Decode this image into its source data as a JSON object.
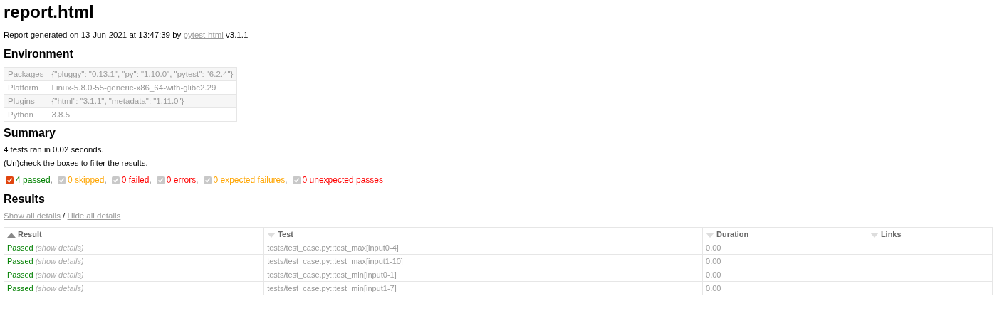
{
  "title": "report.html",
  "generated": {
    "prefix": "Report generated on 13-Jun-2021 at 13:47:39 by",
    "link": "pytest-html",
    "suffix": "v3.1.1"
  },
  "environment": {
    "heading": "Environment",
    "rows": [
      {
        "key": "Packages",
        "value": "{\"pluggy\": \"0.13.1\", \"py\": \"1.10.0\", \"pytest\": \"6.2.4\"}"
      },
      {
        "key": "Platform",
        "value": "Linux-5.8.0-55-generic-x86_64-with-glibc2.29"
      },
      {
        "key": "Plugins",
        "value": "{\"html\": \"3.1.1\", \"metadata\": \"1.11.0\"}"
      },
      {
        "key": "Python",
        "value": "3.8.5"
      }
    ]
  },
  "summary": {
    "heading": "Summary",
    "lines": [
      "4 tests ran in 0.02 seconds.",
      "(Un)check the boxes to filter the results."
    ],
    "filters": [
      {
        "label": "4 passed",
        "separator": ",",
        "checked": true,
        "disabled": false,
        "color": "#008000"
      },
      {
        "label": "0 skipped",
        "separator": ",",
        "checked": true,
        "disabled": true,
        "color": "#ffa500"
      },
      {
        "label": "0 failed",
        "separator": ",",
        "checked": true,
        "disabled": true,
        "color": "#ff0000"
      },
      {
        "label": "0 errors",
        "separator": ",",
        "checked": true,
        "disabled": true,
        "color": "#ff0000"
      },
      {
        "label": "0 expected failures",
        "separator": ",",
        "checked": true,
        "disabled": true,
        "color": "#ffa500"
      },
      {
        "label": "0 unexpected passes",
        "checked": true,
        "disabled": true,
        "color": "#ff0000"
      }
    ]
  },
  "results": {
    "heading": "Results",
    "show_all": "Show all details",
    "slash": "/",
    "hide_all": "Hide all details",
    "columns": [
      {
        "label": "Result",
        "sorted": true
      },
      {
        "label": "Test",
        "sorted": false
      },
      {
        "label": "Duration",
        "sorted": false
      },
      {
        "label": "Links",
        "sorted": false
      }
    ],
    "rows": [
      {
        "result": "Passed",
        "details": "(show details)",
        "test": "tests/test_case.py::test_max[input0-4]",
        "duration": "0.00"
      },
      {
        "result": "Passed",
        "details": "(show details)",
        "test": "tests/test_case.py::test_max[input1-10]",
        "duration": "0.00"
      },
      {
        "result": "Passed",
        "details": "(show details)",
        "test": "tests/test_case.py::test_min[input0-1]",
        "duration": "0.00"
      },
      {
        "result": "Passed",
        "details": "(show details)",
        "test": "tests/test_case.py::test_min[input1-7]",
        "duration": "0.00"
      }
    ]
  }
}
